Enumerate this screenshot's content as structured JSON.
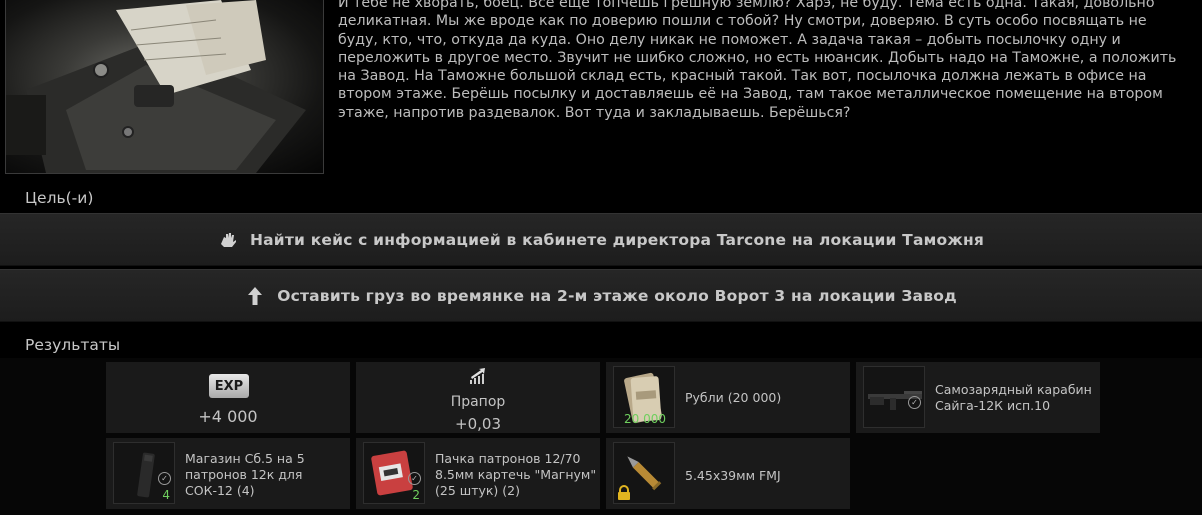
{
  "quest": {
    "description": "И тебе не хворать, боец. Всё ещё топчешь грешную землю? Харэ, не буду. Тема есть одна. Такая, довольно деликатная. Мы же вроде как по доверию пошли с тобой? Ну смотри, доверяю. В суть особо посвящать не буду, кто, что, откуда да куда. Оно делу никак не поможет. А задача такая – добыть посылочку одну и переложить в другое место. Звучит не шибко сложно, но есть нюансик. Добыть надо на Таможне, а положить на Завод. На Таможне большой склад есть, красный такой. Так вот, посылочка должна лежать в офисе на втором этаже. Берёшь посылку и доставляешь её на Завод, там такое металлическое помещение на втором этаже, напротив раздевалок. Вот туда и закладываешь. Берёшься?"
  },
  "objectives_title": "Цель(-и)",
  "objectives": [
    {
      "text": "Найти кейс с информацией в кабинете директора Tarcone на локации Таможня",
      "icon": "hand-icon"
    },
    {
      "text": "Оставить груз во времянке на 2-м этаже около Ворот 3 на локации Завод",
      "icon": "arrow-up-icon"
    }
  ],
  "rewards_title": "Результаты",
  "rewards": {
    "exp": {
      "badge": "EXP",
      "value": "+4 000"
    },
    "standing": {
      "trader": "Прапор",
      "value": "+0,03"
    },
    "items": [
      {
        "label": "Рубли (20 000)",
        "count": "20 000"
      },
      {
        "label": "Самозарядный карабин Сайга-12К исп.10",
        "count": ""
      },
      {
        "label": "Магазин Сб.5 на 5 патронов 12к для СОК-12 (4)",
        "count": "4"
      },
      {
        "label": "Пачка патронов 12/70 8.5мм картечь \"Магнум\" (25 штук) (2)",
        "count": "2"
      },
      {
        "label": "5.45x39мм FMJ",
        "count": ""
      }
    ]
  },
  "colors": {
    "count_green": "#6fcf5e",
    "panel": "#1a1a1a",
    "lock_yellow": "#e0b420"
  }
}
